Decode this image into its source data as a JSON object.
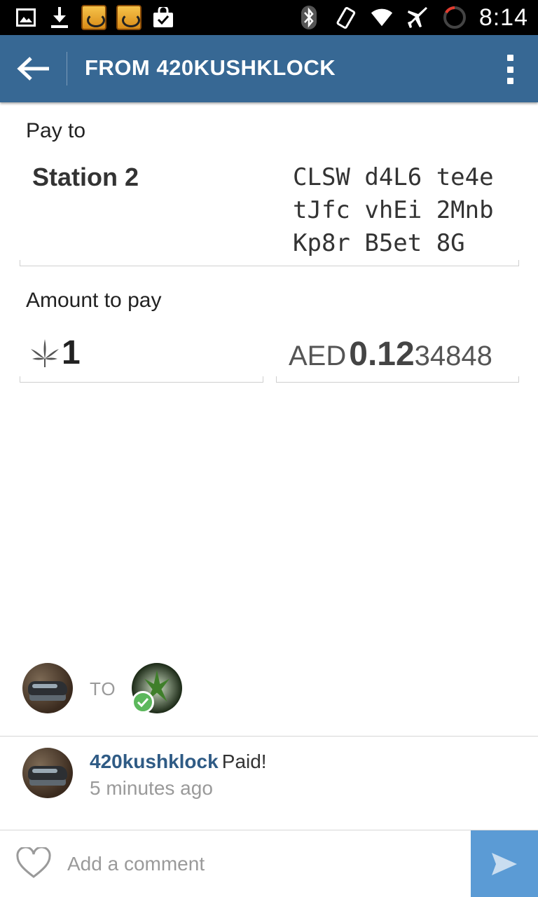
{
  "status_bar": {
    "time": "8:14",
    "left_icons": [
      "image-icon",
      "download-icon",
      "game-icon",
      "game-icon",
      "store-bag-icon"
    ],
    "right_icons": [
      "bluetooth-icon",
      "vibrate-icon",
      "wifi-icon",
      "airplane-icon",
      "battery-ring-icon"
    ]
  },
  "app_bar": {
    "title": "FROM 420KUSHKLOCK",
    "color": "#376894"
  },
  "payment": {
    "pay_to_label": "Pay to",
    "payee_name": "Station 2",
    "address_lines": [
      "CLSW d4L6 te4e",
      "tJfc vhEi 2Mnb",
      "Kp8r B5et 8G"
    ],
    "amount_label": "Amount to pay",
    "amount_value": "1",
    "currency_icon": "leaf-icon",
    "fiat_currency": "AED",
    "fiat_major": "0.12",
    "fiat_minor": "34848"
  },
  "transfer": {
    "to_label": "TO",
    "recipient_status": "confirmed"
  },
  "activity": {
    "username": "420kushklock",
    "action": "Paid!",
    "time": "5 minutes ago"
  },
  "comment_bar": {
    "placeholder": "Add a comment",
    "send_color": "#5b9bd5"
  }
}
